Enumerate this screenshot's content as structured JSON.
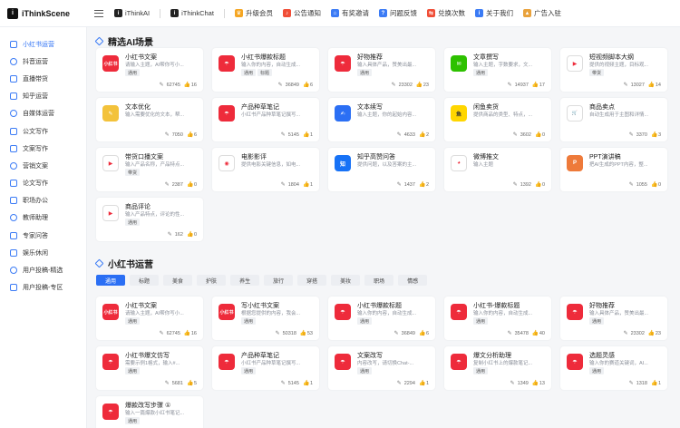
{
  "brand": {
    "name": "iThinkScene",
    "logo_letter": "i"
  },
  "topnav": [
    {
      "label": "iThinkAI",
      "color": "#222222",
      "glyph": "i",
      "icon": "ithinkai-logo-icon"
    },
    {
      "label": "iThinkChat",
      "color": "#222222",
      "glyph": "i",
      "icon": "ithinkchat-logo-icon"
    },
    {
      "label": "升级会员",
      "color": "#f5a623",
      "glyph": "♛",
      "icon": "crown-icon"
    },
    {
      "label": "公告通知",
      "color": "#f04e37",
      "glyph": "♪",
      "icon": "megaphone-icon"
    },
    {
      "label": "有奖邀请",
      "color": "#3b7bf5",
      "glyph": "⌂",
      "icon": "gift-icon"
    },
    {
      "label": "问题反馈",
      "color": "#3b7bf5",
      "glyph": "?",
      "icon": "question-icon"
    },
    {
      "label": "兑换次数",
      "color": "#f04e37",
      "glyph": "⇆",
      "icon": "exchange-icon"
    },
    {
      "label": "关于我们",
      "color": "#3b7bf5",
      "glyph": "i",
      "icon": "info-icon"
    },
    {
      "label": "广告入驻",
      "color": "#e9a23b",
      "glyph": "▲",
      "icon": "flag-icon"
    }
  ],
  "sidebar": [
    {
      "label": "小红书运营",
      "active": true
    },
    {
      "label": "抖音运营"
    },
    {
      "label": "直播带货"
    },
    {
      "label": "知乎运营"
    },
    {
      "label": "自媒体运营"
    },
    {
      "label": "公文写作"
    },
    {
      "label": "文案写作"
    },
    {
      "label": "营销文案"
    },
    {
      "label": "论文写作"
    },
    {
      "label": "职场办公"
    },
    {
      "label": "教师助理"
    },
    {
      "label": "专家问答"
    },
    {
      "label": "娱乐休闲"
    },
    {
      "label": "用户投稿-精选"
    },
    {
      "label": "用户投稿-专区"
    }
  ],
  "section1": {
    "title": "精选AI场景",
    "cards": [
      {
        "title": "小红书文案",
        "desc": "请输入主题，AI帮你写小...",
        "badges": [
          "通用"
        ],
        "views": "62745",
        "likes": "16",
        "icon": "xhs-logo",
        "color": "#ee2b3b",
        "glyph": "小红书"
      },
      {
        "title": "小红书爆款标题",
        "desc": "输入你的内容，自动生成...",
        "badges": [
          "通用",
          "标题"
        ],
        "views": "36849",
        "likes": "6",
        "icon": "umbrella",
        "color": "#ee2b3b",
        "glyph": "☂"
      },
      {
        "title": "好物推荐",
        "desc": "输入具体产品，赞美出最...",
        "badges": [
          "通用"
        ],
        "views": "23302",
        "likes": "23",
        "icon": "umbrella",
        "color": "#ee2b3b",
        "glyph": "☂"
      },
      {
        "title": "文章撰写",
        "desc": "输入主题，字数要求，文...",
        "badges": [
          "通用"
        ],
        "views": "14937",
        "likes": "17",
        "icon": "wechat",
        "color": "#2dc100",
        "glyph": "✉"
      },
      {
        "title": "短视频脚本大纲",
        "desc": "提供的视频主题，目标观...",
        "badges": [
          "带货"
        ],
        "views": "13027",
        "likes": "14",
        "icon": "video-play",
        "color": "#ffffff",
        "glyph": "▶"
      },
      {
        "title": "文本优化",
        "desc": "输入需要优化的文本，帮...",
        "badges": [],
        "views": "7050",
        "likes": "6",
        "icon": "notepad",
        "color": "#f3c23b",
        "glyph": "✎"
      },
      {
        "title": "产品种草笔记",
        "desc": "小红书产品种草笔记撰写...",
        "badges": [],
        "views": "5145",
        "likes": "1",
        "icon": "umbrella",
        "color": "#ee2b3b",
        "glyph": "☂"
      },
      {
        "title": "文本续写",
        "desc": "输入主题，你的起始内容...",
        "badges": [],
        "views": "4633",
        "likes": "2",
        "icon": "pen",
        "color": "#2b6ff4",
        "glyph": "✍"
      },
      {
        "title": "闲鱼卖货",
        "desc": "提供商品的类型、特点，...",
        "badges": [],
        "views": "3602",
        "likes": "0",
        "icon": "xianyu",
        "color": "#ffd600",
        "glyph": "鱼"
      },
      {
        "title": "商品卖点",
        "desc": "自动生成用于主图和详情...",
        "badges": [],
        "views": "3370",
        "likes": "3",
        "icon": "cart",
        "color": "#ffffff",
        "glyph": "🛒"
      },
      {
        "title": "带货口播文案",
        "desc": "输入产品名称，产品特点...",
        "badges": [
          "带货"
        ],
        "views": "2387",
        "likes": "0",
        "icon": "video-play",
        "color": "#ffffff",
        "glyph": "▶"
      },
      {
        "title": "电影影评",
        "desc": "提供电影关键信息，如电...",
        "badges": [],
        "views": "1804",
        "likes": "1",
        "icon": "film",
        "color": "#ffffff",
        "glyph": "◉"
      },
      {
        "title": "知乎高赞问答",
        "desc": "提供问题，以及答案的主...",
        "badges": [],
        "views": "1437",
        "likes": "2",
        "icon": "zhihu",
        "color": "#1772f6",
        "glyph": "知"
      },
      {
        "title": "微博推文",
        "desc": "输入主题",
        "badges": [],
        "views": "1392",
        "likes": "0",
        "icon": "weibo",
        "color": "#ffffff",
        "glyph": "◕"
      },
      {
        "title": "PPT演讲稿",
        "desc": "把AI生成的PPT内容，整...",
        "badges": [],
        "views": "1055",
        "likes": "0",
        "icon": "ppt",
        "color": "#ee7a3a",
        "glyph": "P"
      },
      {
        "title": "商品评论",
        "desc": "输入产品特点，评论的性...",
        "badges": [
          "通用"
        ],
        "views": "162",
        "likes": "0",
        "icon": "video-play",
        "color": "#ffffff",
        "glyph": "▶"
      }
    ]
  },
  "section2": {
    "title": "小红书运营",
    "tags": [
      "通用",
      "标题",
      "美食",
      "护肤",
      "养生",
      "旅行",
      "穿搭",
      "美妆",
      "职场",
      "情感"
    ],
    "active_tag": 0,
    "cards": [
      {
        "title": "小红书文案",
        "desc": "请输入主题，AI帮你写小...",
        "badges": [
          "通用"
        ],
        "views": "62745",
        "likes": "16",
        "icon": "xhs-logo",
        "color": "#ee2b3b",
        "glyph": "小红书"
      },
      {
        "title": "写小红书文案",
        "desc": "根据您提供的内容，我会...",
        "badges": [
          "通用"
        ],
        "views": "50318",
        "likes": "53",
        "icon": "xhs-logo",
        "color": "#ee2b3b",
        "glyph": "小红书"
      },
      {
        "title": "小红书爆款标题",
        "desc": "输入你的内容，自动生成...",
        "badges": [
          "通用"
        ],
        "views": "36849",
        "likes": "6",
        "icon": "umbrella",
        "color": "#ee2b3b",
        "glyph": "☂"
      },
      {
        "title": "小红书-爆款标题",
        "desc": "输入你的内容，自动生成...",
        "badges": [
          "通用"
        ],
        "views": "35478",
        "likes": "40",
        "icon": "umbrella",
        "color": "#ee2b3b",
        "glyph": "☂"
      },
      {
        "title": "好物推荐",
        "desc": "输入具体产品，赞美出最...",
        "badges": [
          "通用"
        ],
        "views": "23302",
        "likes": "23",
        "icon": "umbrella",
        "color": "#ee2b3b",
        "glyph": "☂"
      },
      {
        "title": "小红书爆文仿写",
        "desc": "需要示例1格式，输入#...",
        "badges": [
          "通用"
        ],
        "views": "5681",
        "likes": "5",
        "icon": "umbrella",
        "color": "#ee2b3b",
        "glyph": "☂"
      },
      {
        "title": "产品种草笔记",
        "desc": "小红书产品种草笔记撰写...",
        "badges": [
          "通用"
        ],
        "views": "5145",
        "likes": "1",
        "icon": "umbrella",
        "color": "#ee2b3b",
        "glyph": "☂"
      },
      {
        "title": "文案改写",
        "desc": "内容改写，请切换Chat-...",
        "badges": [
          "通用"
        ],
        "views": "2294",
        "likes": "1",
        "icon": "umbrella",
        "color": "#ee2b3b",
        "glyph": "☂"
      },
      {
        "title": "爆文分析助理",
        "desc": "复制小红书上的爆款笔记...",
        "badges": [
          "通用"
        ],
        "views": "1349",
        "likes": "13",
        "icon": "umbrella",
        "color": "#ee2b3b",
        "glyph": "☂"
      },
      {
        "title": "选题灵感",
        "desc": "输入你的赛道关键词，AI...",
        "badges": [
          "通用"
        ],
        "views": "1318",
        "likes": "1",
        "icon": "umbrella",
        "color": "#ee2b3b",
        "glyph": "☂"
      },
      {
        "title": "爆款改写步骤 ①",
        "desc": "输入一篇爆款小红书笔记...",
        "badges": [
          "通用"
        ],
        "views": "",
        "likes": "",
        "icon": "umbrella",
        "color": "#ee2b3b",
        "glyph": "☂"
      }
    ]
  },
  "colors": {
    "accent": "#2b6ff4",
    "xhs_red": "#ee2b3b"
  }
}
